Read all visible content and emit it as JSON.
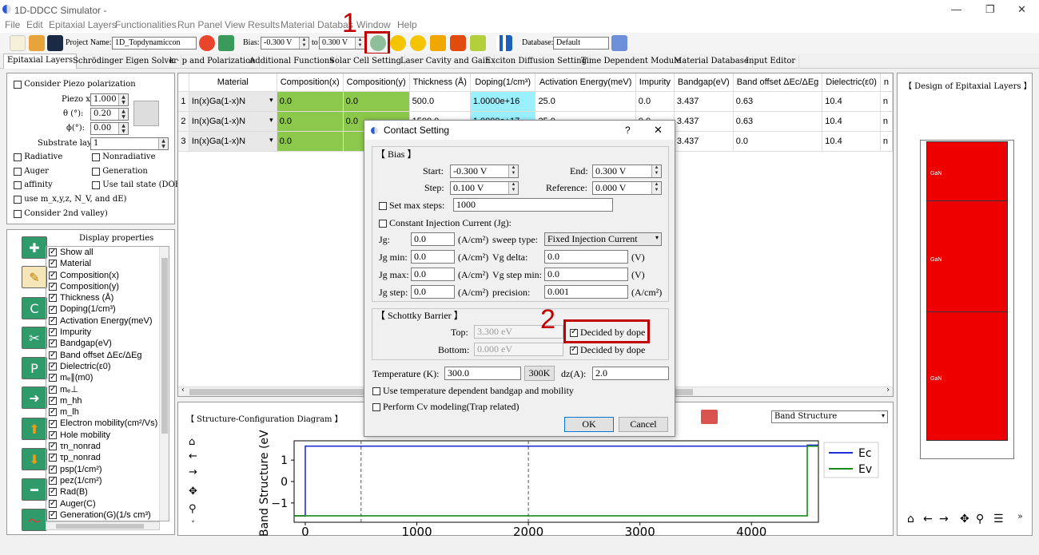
{
  "window": {
    "title": "1D-DDCC Simulator -"
  },
  "menu": [
    "File",
    "Edit",
    "Epitaxial Layers",
    "Functionalities",
    "Run Panel",
    "View Results",
    "Material Databas",
    "Window",
    "Help"
  ],
  "toolbar": {
    "project_label": "Project Name:",
    "project_value": "1D_Topdynamiccon",
    "bias_label": "Bias:",
    "bias_start": "-0.300 V",
    "to_label": "to",
    "bias_end": "0.300 V",
    "database_label": "Database:",
    "database_value": "Default"
  },
  "tabs": [
    "Epitaxial Layers",
    "Schrödinger Eigen Solver",
    "k · p and Polarization",
    "Additional Functions",
    "Solar Cell Setting",
    "Laser Cavity and Gain",
    "Exciton Diffusion Setting",
    "Time Dependent Module",
    "Material Database",
    "Input Editor"
  ],
  "piezo": {
    "consider": "Consider Piezo polarization",
    "piezo_x_label": "Piezo x",
    "piezo_x": "1.000",
    "theta_label": "θ (°):",
    "theta": "0.20",
    "phi_label": "ϕ(°):",
    "phi": "0.00",
    "substrate_label": "Substrate layer:",
    "substrate": "1",
    "options": [
      "Radiative",
      "Nonradiative",
      "Auger",
      "Generation",
      "affinity",
      "Use tail state (DOE)",
      "use m_x,y,z, N_V, and dE)",
      "Consider 2nd valley)"
    ]
  },
  "display": {
    "title": "Display properties",
    "items": [
      "Show all",
      "Material",
      "Composition(x)",
      "Composition(y)",
      "Thickness (Å)",
      "Doping(1/cm³)",
      "Activation Energy(meV)",
      "Impurity",
      "Bandgap(eV)",
      "Band offset ΔEc/ΔEg",
      "Dielectric(ε0)",
      "mₑ∥(m0)",
      "mₑ⊥",
      "m_hh",
      "m_lh",
      "Electron mobility(cm²/Vs)",
      "Hole mobility",
      "τn_nonrad",
      "τp_nonrad",
      "psp(1/cm²)",
      "pez(1/cm²)",
      "Rad(B)",
      "Auger(C)",
      "Generation(G)(1/s cm³)"
    ]
  },
  "table": {
    "headers": [
      "Material",
      "Composition(x)",
      "Composition(y)",
      "Thickness (Å)",
      "Doping(1/cm³)",
      "Activation Energy(meV)",
      "Impurity",
      "Bandgap(eV)",
      "Band offset ΔEc/ΔEg",
      "Dielectric(ε0)",
      "n"
    ],
    "rows": [
      {
        "n": "1",
        "cells": [
          "In(x)Ga(1-x)N",
          "0.0",
          "0.0",
          "500.0",
          "1.0000e+16",
          "25.0",
          "0.0",
          "3.437",
          "0.63",
          "10.4",
          "n"
        ]
      },
      {
        "n": "2",
        "cells": [
          "In(x)Ga(1-x)N",
          "0.0",
          "0.0",
          "1500.0",
          "1.0000e+17",
          "25.0",
          "0.0",
          "3.437",
          "0.63",
          "10.4",
          "n"
        ]
      },
      {
        "n": "3",
        "cells": [
          "In(x)Ga(1-x)N",
          "0.0",
          "",
          "",
          "",
          "",
          "0.0",
          "3.437",
          "0.0",
          "10.4",
          "n"
        ]
      }
    ]
  },
  "structure": {
    "title": "【 Structure-Configuration Diagram 】",
    "plot_select": "Band Structure"
  },
  "design": {
    "title": "【 Design of Epitaxial Layers 】",
    "layers": [
      "GaN",
      "GaN",
      "GaN"
    ]
  },
  "chart_data": {
    "type": "line",
    "xlabel": "",
    "ylabel": "Band Structure (eV",
    "xlim": [
      0,
      4700
    ],
    "ylim": [
      -1.9,
      1.9
    ],
    "xticks": [
      "0",
      "1000",
      "2000",
      "3000",
      "4000"
    ],
    "yticks": [
      "1",
      "0",
      "−1"
    ],
    "series": [
      {
        "name": "Ec",
        "color": "#1f2fd6",
        "points": [
          [
            -100,
            -1.6
          ],
          [
            0,
            -1.6
          ],
          [
            0,
            1.65
          ],
          [
            4500,
            1.65
          ],
          [
            4500,
            1.7
          ],
          [
            4600,
            1.7
          ]
        ]
      },
      {
        "name": "Ev",
        "color": "#1a8a1a",
        "points": [
          [
            -100,
            -1.6
          ],
          [
            0,
            -1.6
          ],
          [
            4500,
            -1.6
          ],
          [
            4500,
            1.65
          ],
          [
            4600,
            1.65
          ]
        ]
      }
    ],
    "vlines": [
      500,
      2000
    ]
  },
  "dialog": {
    "title": "Contact Setting",
    "help": "?",
    "close": "✕",
    "bias_group": "【 Bias 】",
    "start_label": "Start:",
    "start": "-0.300 V",
    "end_label": "End:",
    "end": "0.300 V",
    "step_label": "Step:",
    "step": "0.100 V",
    "reference_label": "Reference:",
    "reference": "0.000 V",
    "max_steps_label": "Set max steps:",
    "max_steps": "1000",
    "const_inj": "Constant Injection Current (Jg):",
    "jg_label": "Jg:",
    "jg": "0.0",
    "unit_acm2": "(A/cm²)",
    "sweep_label": "sweep type:",
    "sweep": "Fixed Injection Current",
    "jgmin_label": "Jg min:",
    "jgmin": "0.0",
    "vgdelta_label": "Vg delta:",
    "vgdelta": "0.0",
    "unit_v": "(V)",
    "jgmax_label": "Jg max:",
    "jgmax": "0.0",
    "vgmax_label": "Vg step min:",
    "vgmax": "0.0",
    "jgstep_label": "Jg step:",
    "jgstep": "0.0",
    "precision_label": "precision:",
    "precision": "0.001",
    "schottky_group": "【 Schottky Barrier 】",
    "top_label": "Top:",
    "top": "3.300 eV",
    "bottom_label": "Bottom:",
    "bottom": "0.000 eV",
    "decided": "Decided by dope",
    "temp_label": "Temperature (K):",
    "temp": "300.0",
    "temp_btn": "300K",
    "dz_label": "dz(A):",
    "dz": "2.0",
    "temp_dep": "Use temperature dependent bandgap and mobility",
    "cv": "Perform Cv modeling(Trap related)",
    "ok": "OK",
    "cancel": "Cancel"
  },
  "annotations": {
    "one": "1",
    "two": "2"
  }
}
